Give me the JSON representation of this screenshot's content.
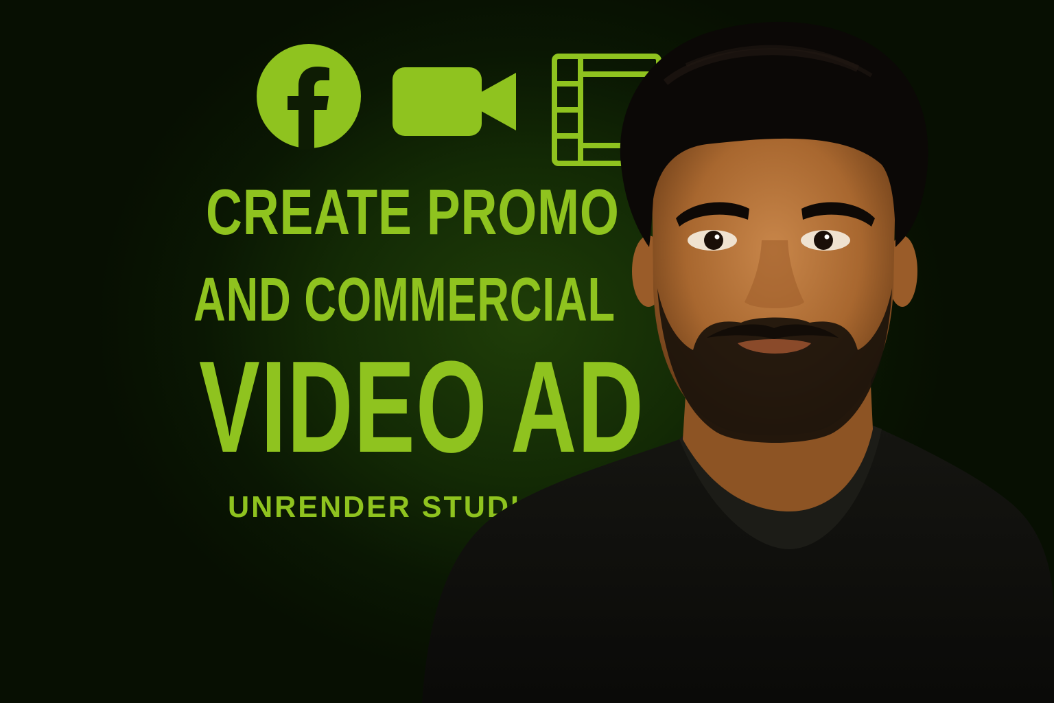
{
  "headline": {
    "line1": "CREATE PROMO",
    "line2": "AND COMMERCIAL",
    "line3": "VIDEO AD"
  },
  "brand": "UNRENDER STUDIOS",
  "icons": [
    "facebook-icon",
    "video-camera-icon",
    "film-strip-icon"
  ],
  "colors": {
    "accent": "#8fc31f",
    "background": "#0a1703",
    "shirt": "#0d0d0b",
    "skin": "#b4733e",
    "hair": "#0b0806"
  }
}
